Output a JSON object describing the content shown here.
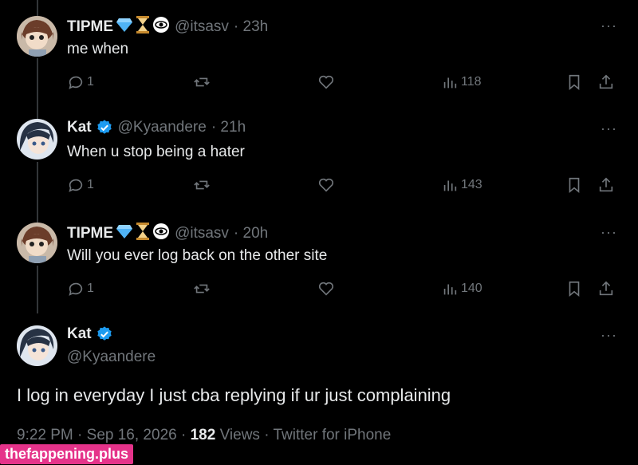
{
  "replies": [
    {
      "name": "TIPME",
      "emojis": [
        "gem",
        "hourglass",
        "eye-in-bubble"
      ],
      "handle": "@itsasv",
      "time": "· 23h",
      "text": "me when",
      "replies_count": "1",
      "views": "118"
    },
    {
      "name": "Kat",
      "verified": true,
      "handle": "@Kyaandere",
      "time": "· 21h",
      "text": "When u stop being a hater",
      "replies_count": "1",
      "views": "143"
    },
    {
      "name": "TIPME",
      "emojis": [
        "gem",
        "hourglass",
        "eye-in-bubble"
      ],
      "handle": "@itsasv",
      "time": "· 20h",
      "text": "Will you ever log back on the other site",
      "replies_count": "1",
      "views": "140"
    }
  ],
  "main_tweet": {
    "name": "Kat",
    "verified": true,
    "handle": "@Kyaandere",
    "text": "I log in everyday I just cba replying if ur just complaining",
    "time": "9:22 PM",
    "date": "Sep 16, 2026",
    "views_count": "182",
    "views_label": "Views",
    "source": "Twitter for iPhone"
  },
  "more_label": "···",
  "watermark": "thefappening.plus",
  "colors": {
    "background": "#000000",
    "text": "#e7e9ea",
    "muted": "#71767b",
    "verified": "#1d9bf0",
    "watermark": "#e5338a"
  }
}
